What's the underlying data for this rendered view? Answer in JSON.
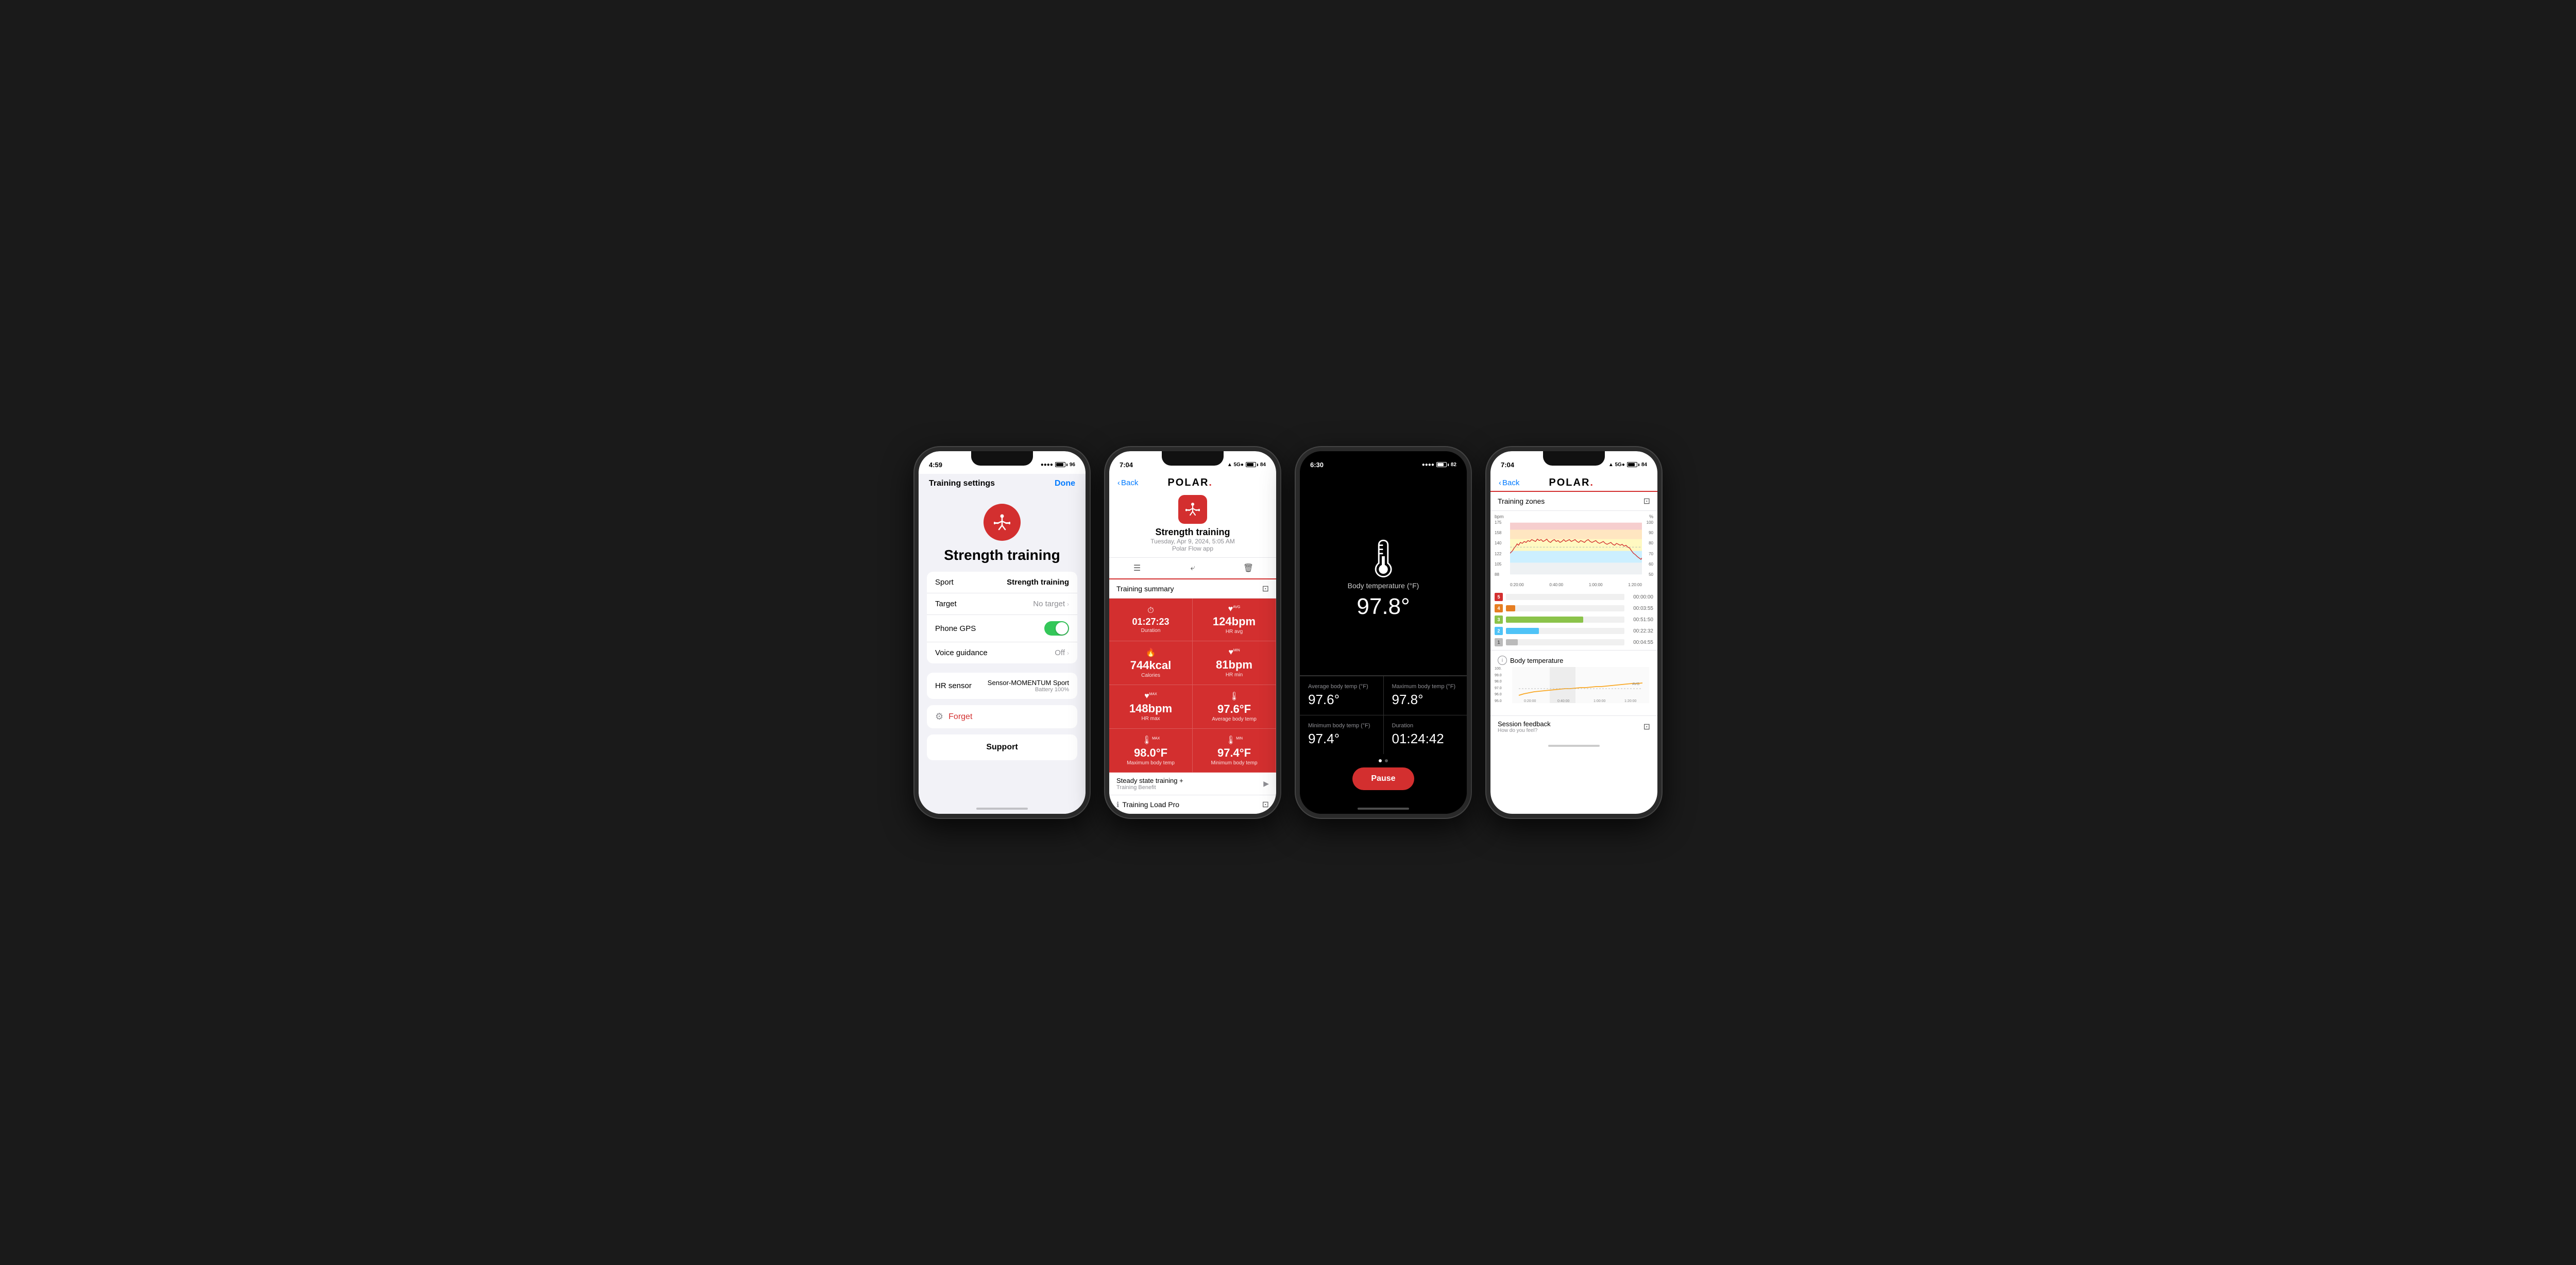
{
  "phone1": {
    "status": {
      "time": "4:59",
      "signal": "●●●●",
      "battery": "96"
    },
    "nav": {
      "title": "Training settings",
      "done": "Done"
    },
    "sport_title": "Strength training",
    "settings": [
      {
        "label": "Sport",
        "value": "Strength training",
        "bold": true,
        "type": "text"
      },
      {
        "label": "Target",
        "value": "No target",
        "bold": false,
        "type": "chevron"
      },
      {
        "label": "Phone GPS",
        "value": "",
        "type": "toggle"
      },
      {
        "label": "Voice guidance",
        "value": "Off",
        "bold": false,
        "type": "chevron"
      }
    ],
    "hr_sensor": {
      "label": "HR sensor",
      "value": "Sensor-MOMENTUM Sport",
      "battery": "Battery 100%"
    },
    "forget_label": "Forget",
    "support_label": "Support"
  },
  "phone2": {
    "status": {
      "time": "7:04",
      "signal": "5G●",
      "battery": "84"
    },
    "nav": {
      "back": "Back",
      "logo": "POLAR."
    },
    "activity": {
      "name": "Strength training",
      "date": "Tuesday, Apr 9, 2024, 5:05 AM",
      "source": "Polar Flow app"
    },
    "sections": {
      "training_summary": "Training summary",
      "training_benefit": "Training Benefit",
      "steady_state": "Steady state training +",
      "training_load_pro": "Training Load Pro"
    },
    "metrics": [
      {
        "icon": "⏱",
        "value": "01:27:23",
        "label": "Duration",
        "size": "med"
      },
      {
        "icon": "♥",
        "value": "124bpm",
        "label": "HR avg",
        "avg": true
      },
      {
        "icon": "🔥",
        "value": "744kcal",
        "label": "Calories"
      },
      {
        "icon": "♥",
        "value": "81bpm",
        "label": "HR min",
        "min": true
      },
      {
        "icon": "♥",
        "value": "148bpm",
        "label": "HR max",
        "max": true
      },
      {
        "icon": "🌡",
        "value": "97.6°F",
        "label": "Average body temp"
      },
      {
        "icon": "🌡",
        "value": "98.0°F",
        "label": "Maximum body temp",
        "max2": true
      },
      {
        "icon": "🌡",
        "value": "97.4°F",
        "label": "Minimum body temp",
        "min2": true
      }
    ]
  },
  "phone3": {
    "status": {
      "time": "6:30",
      "battery": "82"
    },
    "temp_section": {
      "label": "Body temperature (°F)",
      "value": "97.8°"
    },
    "stats": [
      {
        "label": "Average body temp (°F)",
        "value": "97.6°"
      },
      {
        "label": "Maximum body temp (°F)",
        "value": "97.8°"
      },
      {
        "label": "Minimum body temp (°F)",
        "value": "97.4°"
      },
      {
        "label": "Duration",
        "value": "01:24:42"
      }
    ],
    "pause_btn": "Pause"
  },
  "phone4": {
    "status": {
      "time": "7:04",
      "signal": "5G●",
      "battery": "84"
    },
    "nav": {
      "back": "Back",
      "logo": "POLAR."
    },
    "sections": {
      "training_zones": "Training zones",
      "body_temperature": "Body temperature",
      "session_feedback": "Session feedback",
      "how_do_you_feel": "How do you feel?"
    },
    "chart": {
      "y_left": [
        "88",
        "105",
        "122",
        "140",
        "158",
        "175"
      ],
      "y_right": [
        "50",
        "60",
        "70",
        "80",
        "90",
        "100"
      ],
      "x_labels": [
        "0:20:00",
        "0:40:00",
        "1:00:00",
        "1:20:00"
      ],
      "y_left_label": "bpm",
      "y_right_label": "%"
    },
    "zones": [
      {
        "num": "5",
        "color": "#d32f2f",
        "time": "00:00:00",
        "width": 0
      },
      {
        "num": "4",
        "color": "#e67e22",
        "time": "00:03:55",
        "width": 8
      },
      {
        "num": "3",
        "color": "#8bc34a",
        "time": "00:51:50",
        "width": 60
      },
      {
        "num": "2",
        "color": "#4fc3f7",
        "time": "00:22:32",
        "width": 30
      },
      {
        "num": "1",
        "color": "#bbb",
        "time": "00:04:55",
        "width": 10
      }
    ],
    "temp_chart": {
      "y_labels": [
        "95.0",
        "96.0",
        "97.0",
        "98.0",
        "99.0",
        "100."
      ],
      "x_labels": [
        "0:20:00",
        "0:40:00",
        "1:00:00",
        "1:20:00"
      ],
      "avg_label": "AVG"
    }
  }
}
